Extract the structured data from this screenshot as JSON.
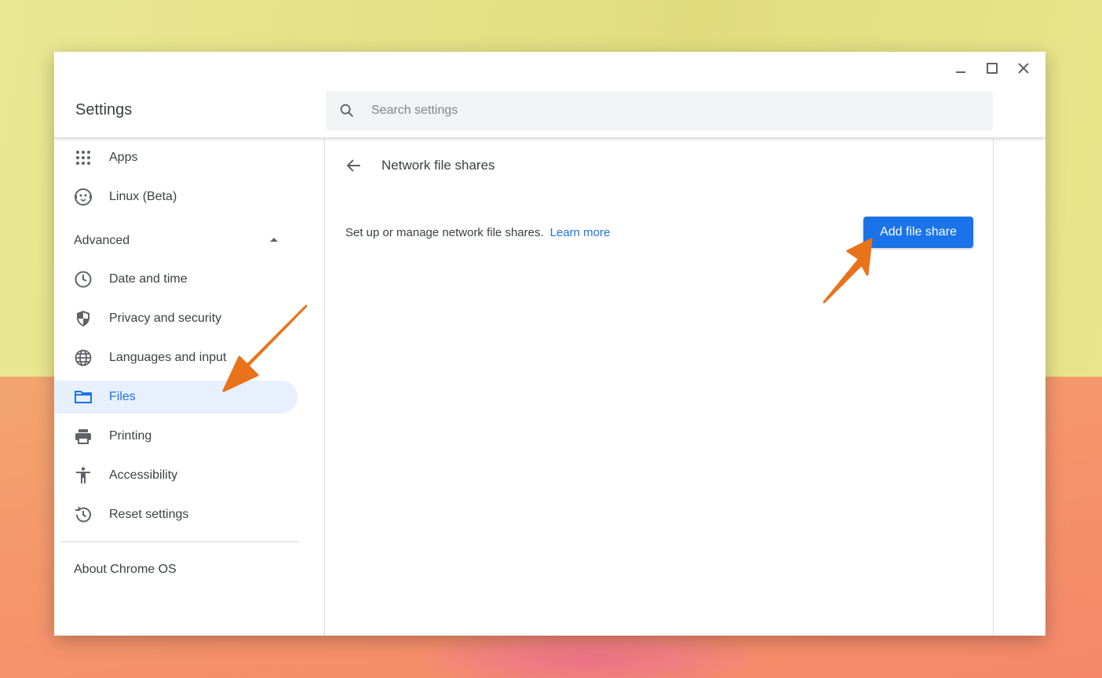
{
  "window": {
    "title": "Settings",
    "controls": [
      "minimize",
      "maximize",
      "close"
    ]
  },
  "search": {
    "placeholder": "Search settings"
  },
  "sidebar": {
    "items": [
      {
        "label": "Apps",
        "icon": "apps-grid-icon"
      },
      {
        "label": "Linux (Beta)",
        "icon": "linux-penguin-icon"
      }
    ],
    "advanced_label": "Advanced",
    "advanced_items": [
      {
        "label": "Date and time",
        "icon": "clock-icon"
      },
      {
        "label": "Privacy and security",
        "icon": "shield-icon"
      },
      {
        "label": "Languages and input",
        "icon": "globe-icon"
      },
      {
        "label": "Files",
        "icon": "folder-icon",
        "active": true
      },
      {
        "label": "Printing",
        "icon": "printer-icon"
      },
      {
        "label": "Accessibility",
        "icon": "accessibility-icon"
      },
      {
        "label": "Reset settings",
        "icon": "history-icon"
      }
    ],
    "about_label": "About Chrome OS"
  },
  "main": {
    "page_title": "Network file shares",
    "description": "Set up or manage network file shares.",
    "learn_more": "Learn more",
    "add_button": "Add file share"
  },
  "colors": {
    "accent": "#1a73e8",
    "active_bg": "#e8f0fe",
    "annotation_arrow": "#e8731a"
  }
}
